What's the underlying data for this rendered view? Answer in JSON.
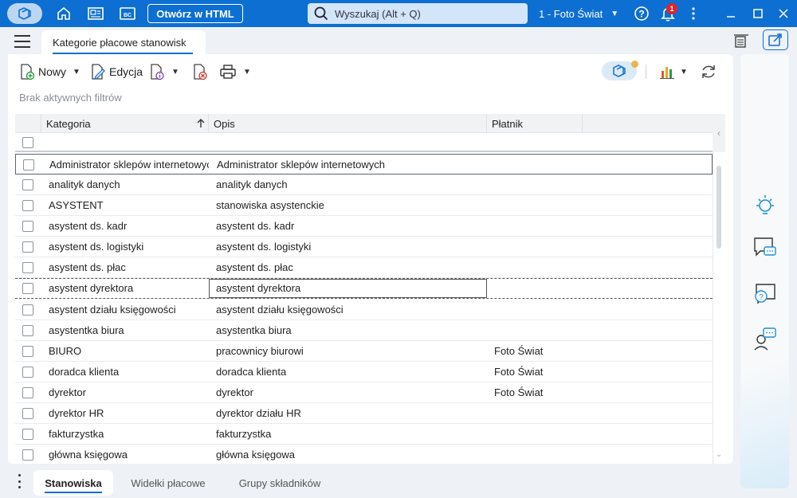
{
  "titlebar": {
    "open_html_label": "Otwórz w HTML",
    "search_placeholder": "Wyszukaj (Alt + Q)",
    "company": "1 - Foto Świat",
    "notifications_count": "1",
    "accent": "#0d6fd1"
  },
  "tab": {
    "title": "Kategorie płacowe stanowisk"
  },
  "toolbar": {
    "new_label": "Nowy",
    "edit_label": "Edycja",
    "filters_text": "Brak aktywnych filtrów"
  },
  "grid": {
    "columns": [
      "Kategoria",
      "Opis",
      "Płatnik"
    ],
    "rows": [
      {
        "kategoria": "Administrator sklepów internetowych",
        "opis": "Administrator sklepów internetowych",
        "platnik": ""
      },
      {
        "kategoria": "analityk danych",
        "opis": "analityk danych",
        "platnik": ""
      },
      {
        "kategoria": "ASYSTENT",
        "opis": "stanowiska asystenckie",
        "platnik": ""
      },
      {
        "kategoria": "asystent ds. kadr",
        "opis": "asystent ds. kadr",
        "platnik": ""
      },
      {
        "kategoria": "asystent ds. logistyki",
        "opis": "asystent ds. logistyki",
        "platnik": ""
      },
      {
        "kategoria": "asystent ds. płac",
        "opis": "asystent ds. płac",
        "platnik": ""
      },
      {
        "kategoria": "asystent dyrektora",
        "opis": "asystent dyrektora",
        "platnik": ""
      },
      {
        "kategoria": "asystent działu księgowości",
        "opis": "asystent działu księgowości",
        "platnik": ""
      },
      {
        "kategoria": "asystentka biura",
        "opis": "asystentka biura",
        "platnik": ""
      },
      {
        "kategoria": "BIURO",
        "opis": "pracownicy biurowi",
        "platnik": "Foto Świat"
      },
      {
        "kategoria": "doradca klienta",
        "opis": "doradca klienta",
        "platnik": "Foto Świat"
      },
      {
        "kategoria": "dyrektor",
        "opis": "dyrektor",
        "platnik": "Foto Świat"
      },
      {
        "kategoria": "dyrektor HR",
        "opis": "dyrektor działu HR",
        "platnik": ""
      },
      {
        "kategoria": "fakturzystka",
        "opis": "fakturzystka",
        "platnik": ""
      },
      {
        "kategoria": "główna księgowa",
        "opis": "główna księgowa",
        "platnik": ""
      }
    ]
  },
  "bottom_tabs": [
    "Stanowiska",
    "Widełki płacowe",
    "Grupy składników"
  ]
}
